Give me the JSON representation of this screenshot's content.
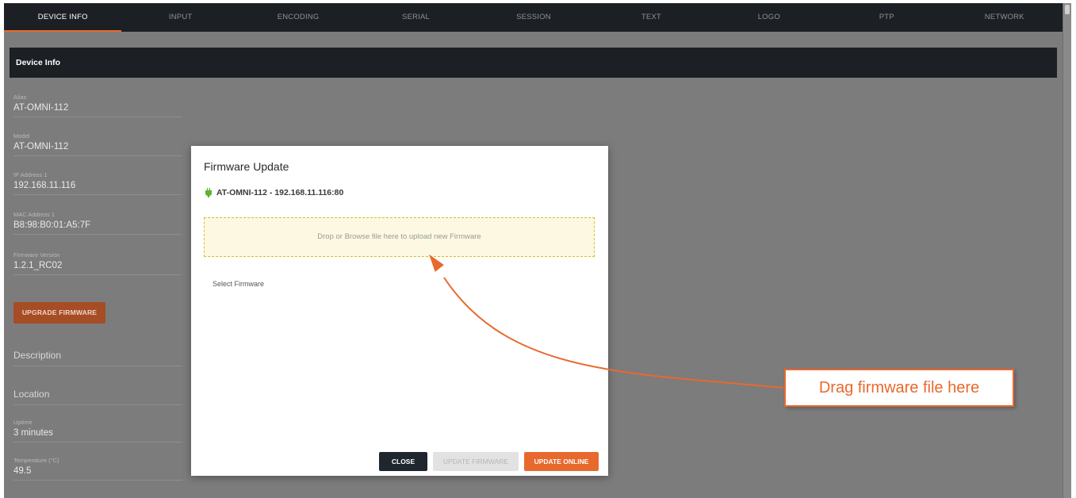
{
  "nav": {
    "tabs": [
      "DEVICE INFO",
      "INPUT",
      "ENCODING",
      "SERIAL",
      "SESSION",
      "TEXT",
      "LOGO",
      "PTP",
      "NETWORK"
    ],
    "active": "DEVICE INFO"
  },
  "section": {
    "title": "Device Info"
  },
  "fields": {
    "alias": {
      "label": "Alias",
      "value": "AT-OMNI-112"
    },
    "model": {
      "label": "Model",
      "value": "AT-OMNI-112"
    },
    "ip": {
      "label": "IP Address 1",
      "value": "192.168.11.116"
    },
    "mac": {
      "label": "MAC Address 1",
      "value": "B8:98:B0:01:A5:7F"
    },
    "firmware": {
      "label": "Firmware Version",
      "value": "1.2.1_RC02"
    },
    "description": {
      "placeholder": "Description"
    },
    "location": {
      "placeholder": "Location"
    },
    "uptime": {
      "label": "Uptime",
      "value": "3 minutes"
    },
    "temperature": {
      "label": "Temperature (°C)",
      "value": "49.5"
    }
  },
  "upgrade_button": "UPGRADE FIRMWARE",
  "modal": {
    "title": "Firmware Update",
    "device": "AT-OMNI-112 - 192.168.11.116:80",
    "device_icon": "plug-icon",
    "dropzone": "Drop or Browse file here to upload new Firmware",
    "select_label": "Select Firmware",
    "buttons": {
      "close": "CLOSE",
      "update_firmware": "UPDATE FIRMWARE",
      "update_online": "UPDATE ONLINE"
    }
  },
  "callout": {
    "text": "Drag firmware file here"
  },
  "colors": {
    "accent": "#e8692d",
    "nav_bg": "#1c1f23",
    "connected": "#5cb531",
    "dropzone_border": "#d8bf1e"
  }
}
